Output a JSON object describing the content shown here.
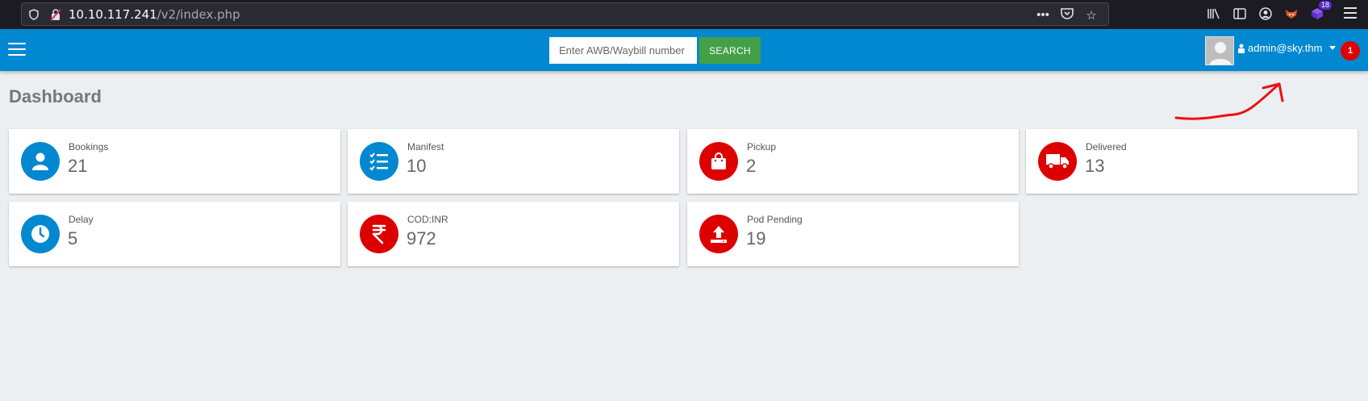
{
  "browser": {
    "url_host": "10.10.117.241",
    "url_path": "/v2/index.php",
    "extension_badge": "18"
  },
  "navbar": {
    "search_placeholder": "Enter AWB/Waybill number",
    "search_label": "SEARCH",
    "user_email": "admin@sky.thm",
    "notification_count": "1",
    "colors": {
      "bar": "#0288d1",
      "search_button": "#43a047",
      "notification": "#e00000"
    }
  },
  "page": {
    "title": "Dashboard"
  },
  "stats": [
    {
      "label": "Bookings",
      "value": "21",
      "icon": "user-icon",
      "color": "#0288d1"
    },
    {
      "label": "Manifest",
      "value": "10",
      "icon": "checklist-icon",
      "color": "#0288d1"
    },
    {
      "label": "Pickup",
      "value": "2",
      "icon": "shopping-bag-icon",
      "color": "#dd0000"
    },
    {
      "label": "Delivered",
      "value": "13",
      "icon": "truck-icon",
      "color": "#dd0000"
    },
    {
      "label": "Delay",
      "value": "5",
      "icon": "clock-icon",
      "color": "#0288d1"
    },
    {
      "label": "COD:INR",
      "value": "972",
      "icon": "rupee-icon",
      "color": "#dd0000"
    },
    {
      "label": "Pod Pending",
      "value": "19",
      "icon": "upload-icon",
      "color": "#dd0000"
    }
  ]
}
